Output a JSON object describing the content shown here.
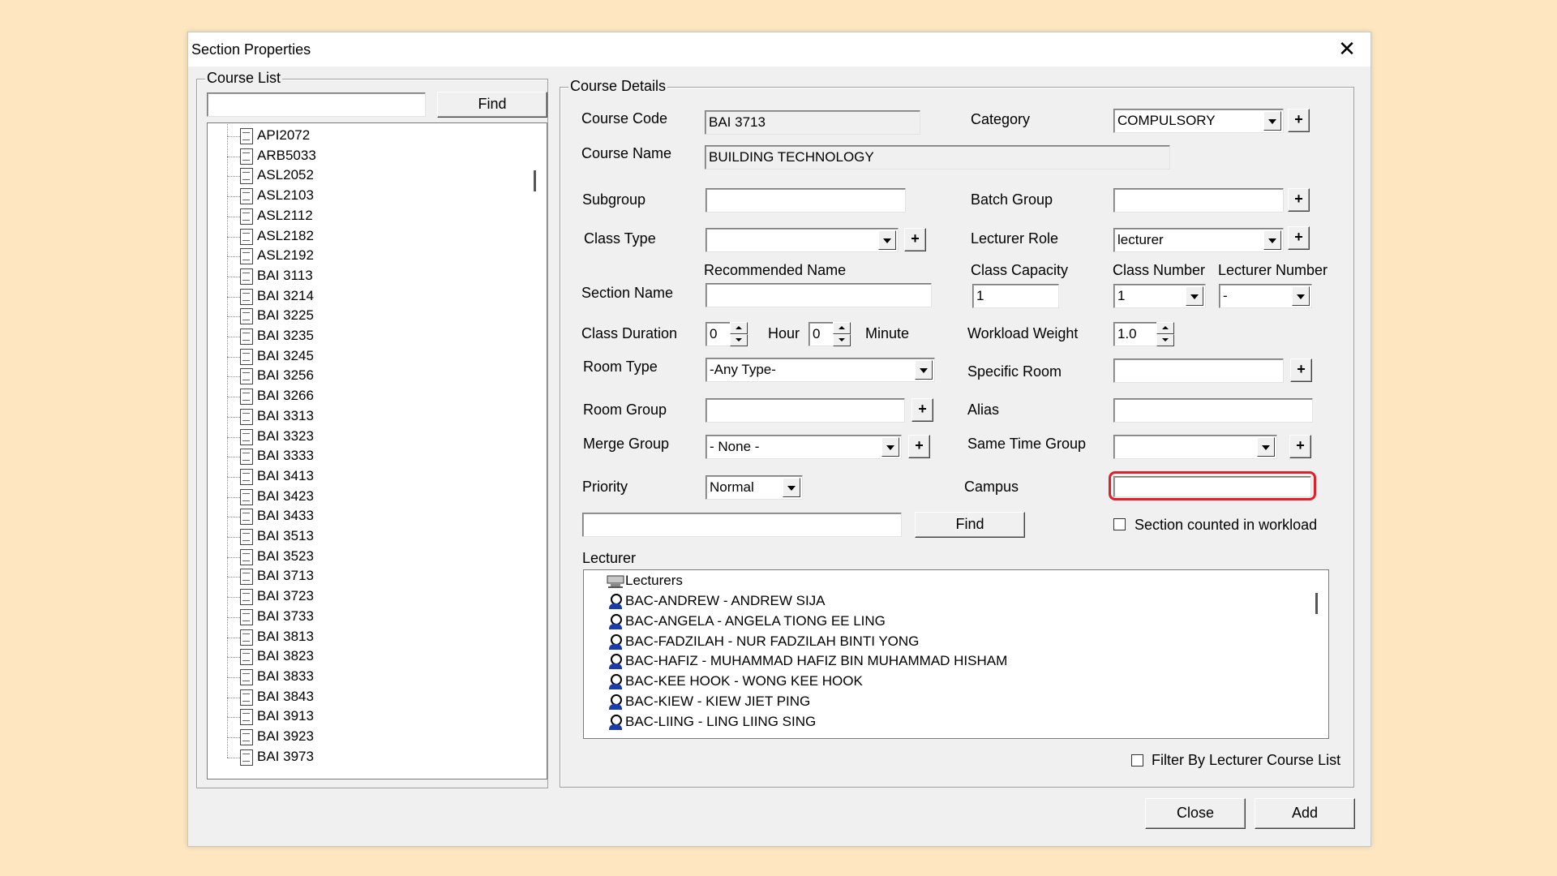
{
  "window": {
    "title": "Section Properties",
    "close_glyph": "✕"
  },
  "course_list": {
    "legend": "Course List",
    "search_value": "",
    "find_label": "Find",
    "items": [
      "API2072",
      "ARB5033",
      "ASL2052",
      "ASL2103",
      "ASL2112",
      "ASL2182",
      "ASL2192",
      "BAI 3113",
      "BAI 3214",
      "BAI 3225",
      "BAI 3235",
      "BAI 3245",
      "BAI 3256",
      "BAI 3266",
      "BAI 3313",
      "BAI 3323",
      "BAI 3333",
      "BAI 3413",
      "BAI 3423",
      "BAI 3433",
      "BAI 3513",
      "BAI 3523",
      "BAI 3713",
      "BAI 3723",
      "BAI 3733",
      "BAI 3813",
      "BAI 3823",
      "BAI 3833",
      "BAI 3843",
      "BAI 3913",
      "BAI 3923",
      "BAI 3973"
    ]
  },
  "course_details": {
    "legend": "Course Details",
    "course_code_label": "Course Code",
    "course_code": "BAI 3713",
    "course_name_label": "Course Name",
    "course_name": "BUILDING TECHNOLOGY",
    "category_label": "Category",
    "category": "COMPULSORY",
    "subgroup_label": "Subgroup",
    "subgroup": "",
    "batch_group_label": "Batch Group",
    "batch_group": "",
    "class_type_label": "Class Type",
    "class_type": "",
    "lecturer_role_label": "Lecturer Role",
    "lecturer_role": "lecturer",
    "recommended_name_label": "Recommended Name",
    "class_capacity_label": "Class Capacity",
    "class_number_label": "Class Number",
    "lecturer_number_label": "Lecturer Number",
    "section_name_label": "Section Name",
    "section_name": "",
    "class_capacity": "1",
    "class_number": "1",
    "lecturer_number": "-",
    "class_duration_label": "Class Duration",
    "hours": "0",
    "hour_label": "Hour",
    "minutes": "0",
    "minute_label": "Minute",
    "workload_weight_label": "Workload Weight",
    "workload_weight": "1.0",
    "room_type_label": "Room Type",
    "room_type": "-Any Type-",
    "specific_room_label": "Specific Room",
    "specific_room": "",
    "room_group_label": "Room Group",
    "room_group": "",
    "alias_label": "Alias",
    "alias": "",
    "merge_group_label": "Merge Group",
    "merge_group": "- None -",
    "same_time_group_label": "Same Time Group",
    "same_time_group": "",
    "priority_label": "Priority",
    "priority": "Normal",
    "campus_label": "Campus",
    "campus": "",
    "lecturer_search": "",
    "find_label": "Find",
    "section_counted_label": "Section counted in workload",
    "plus_glyph": "+"
  },
  "lecturer": {
    "label": "Lecturer",
    "root": "Lecturers",
    "items": [
      "BAC-ANDREW - ANDREW SIJA",
      "BAC-ANGELA - ANGELA TIONG EE LING",
      "BAC-FADZILAH - NUR FADZILAH BINTI YONG",
      "BAC-HAFIZ - MUHAMMAD HAFIZ BIN MUHAMMAD HISHAM",
      "BAC-KEE HOOK - WONG KEE HOOK",
      "BAC-KIEW - KIEW JIET PING",
      "BAC-LIING - LING LIING SING"
    ],
    "filter_label": "Filter By Lecturer Course List"
  },
  "footer": {
    "close_label": "Close",
    "add_label": "Add"
  },
  "colors": {
    "background": "#fde6c0",
    "highlight": "#e0202a"
  }
}
